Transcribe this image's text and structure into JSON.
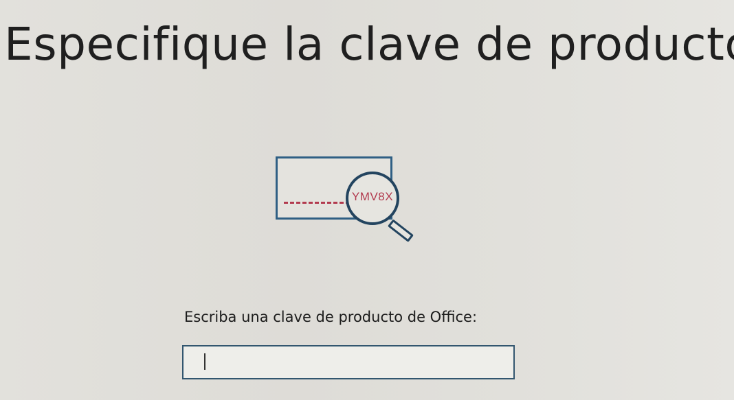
{
  "page": {
    "title": "Especifique la clave de producto"
  },
  "illustration": {
    "magnified_key_text": "YMV8X",
    "icon": "product-key-magnifier-icon",
    "colors": {
      "outline": "#23445f",
      "accent": "#b23a4e"
    }
  },
  "form": {
    "prompt_label": "Escriba una clave de producto de Office:",
    "key_input": {
      "value": "",
      "placeholder": ""
    }
  }
}
